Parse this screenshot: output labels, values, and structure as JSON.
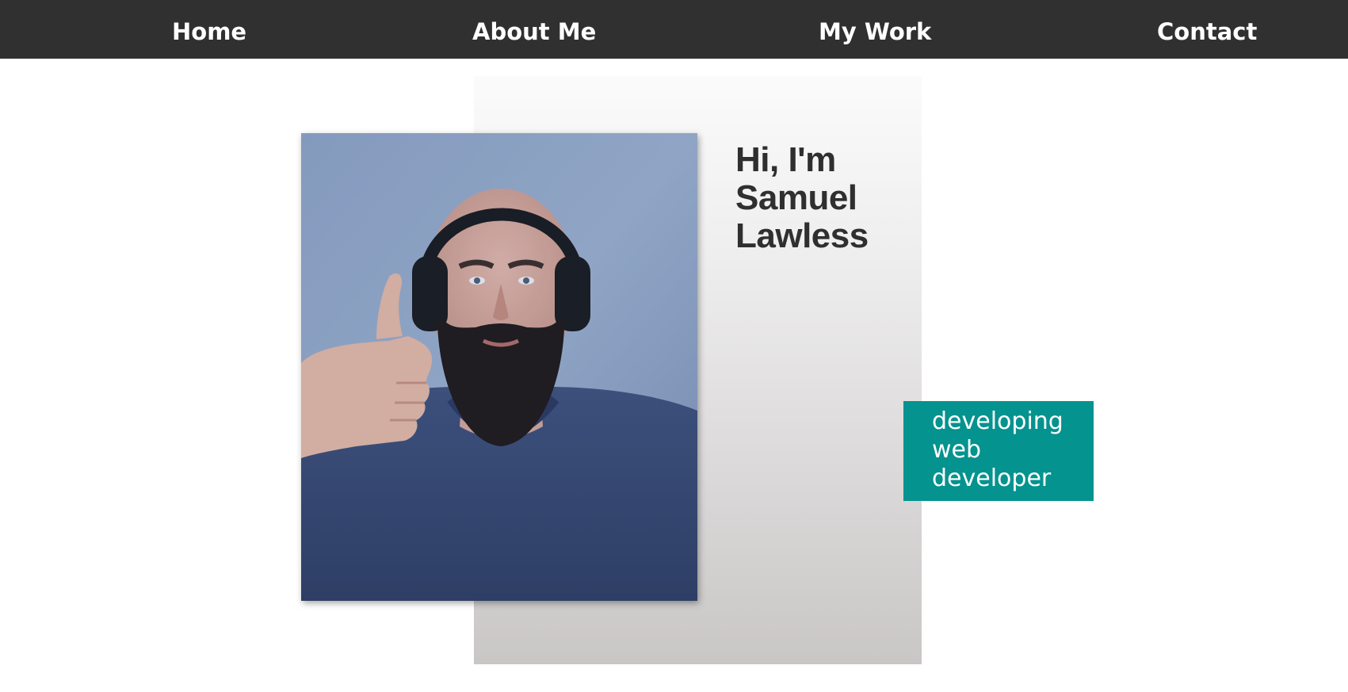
{
  "nav": {
    "home": "Home",
    "about": "About Me",
    "work": "My Work",
    "contact": "Contact"
  },
  "hero": {
    "title_line1": "Hi, I'm",
    "title_line2": "Samuel",
    "title_line3": "Lawless",
    "tagline_line1": "developing",
    "tagline_line2": "web",
    "tagline_line3": "developer"
  },
  "colors": {
    "nav_background": "#303030",
    "nav_text": "#ffffff",
    "accent": "#05938f",
    "title_text": "#2f2f2f"
  }
}
